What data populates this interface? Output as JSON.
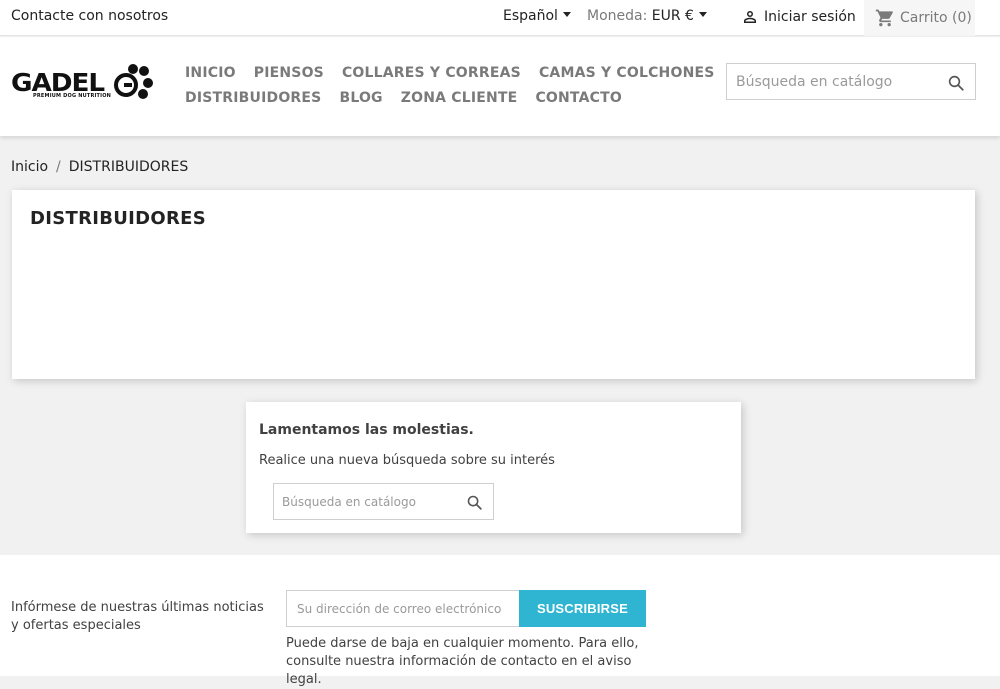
{
  "topbar": {
    "contact": "Contacte con nosotros",
    "language": "Español",
    "currency_label": "Moneda:",
    "currency_value": "EUR €",
    "signin": "Iniciar sesión",
    "cart": "Carrito (0)"
  },
  "header": {
    "logo_text": "GADEL",
    "logo_tagline": "PREMIUM DOG NUTRITION",
    "nav_row1": [
      "INICIO",
      "PIENSOS",
      "COLLARES Y CORREAS",
      "CAMAS Y COLCHONES"
    ],
    "nav_row2": [
      "DISTRIBUIDORES",
      "BLOG",
      "ZONA CLIENTE",
      "CONTACTO"
    ],
    "search_placeholder": "Búsqueda en catálogo"
  },
  "breadcrumb": {
    "home": "Inicio",
    "separator": "/",
    "current": "DISTRIBUIDORES"
  },
  "page": {
    "title": "DISTRIBUIDORES"
  },
  "not_found": {
    "title": "Lamentamos las molestias.",
    "subtitle": "Realice una nueva búsqueda sobre su interés",
    "search_placeholder": "Búsqueda en catálogo"
  },
  "newsletter": {
    "info": "Infórmese de nuestras últimas noticias y ofertas especiales",
    "email_placeholder": "Su dirección de correo electrónico",
    "button": "SUSCRIBIRSE",
    "legal": "Puede darse de baja en cualquier momento. Para ello, consulte nuestra información de contacto en el aviso legal."
  },
  "colors": {
    "accent": "#2fb5d2",
    "nav_text": "#7a7a7a",
    "page_bg": "#f1f1f1"
  },
  "icons": {
    "signin": "person-icon",
    "cart": "cart-icon",
    "search": "search-icon",
    "language_dropdown": "caret-down-icon"
  }
}
